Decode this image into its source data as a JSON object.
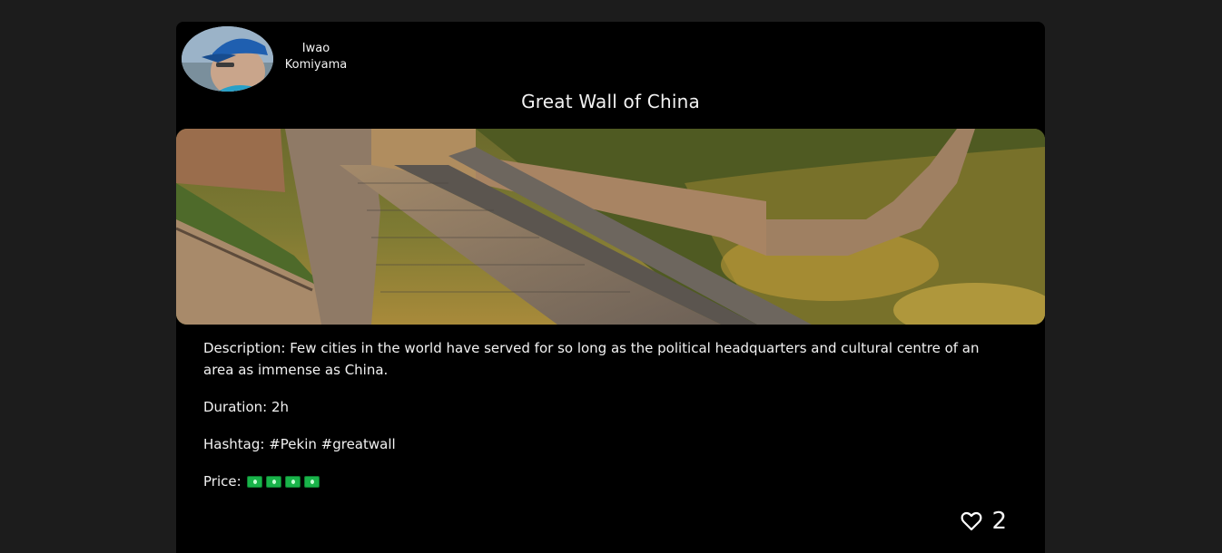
{
  "post": {
    "author": {
      "first_name": "Iwao",
      "last_name": "Komiyama"
    },
    "title": "Great Wall of China",
    "description": "Description: Few cities in the world have served for so long as the political headquarters and cultural centre of an area as immense as China.",
    "duration": "Duration: 2h",
    "hashtags": "Hashtag: #Pekin #greatwall",
    "price_label": "Price:",
    "price_icon": "money-bill-icon",
    "price_level": 4,
    "likes": "2"
  },
  "colors": {
    "page_background": "#1c1c1c",
    "card_background": "#000000",
    "text": "#f2f2f2",
    "price_icon": "#19b34a"
  }
}
